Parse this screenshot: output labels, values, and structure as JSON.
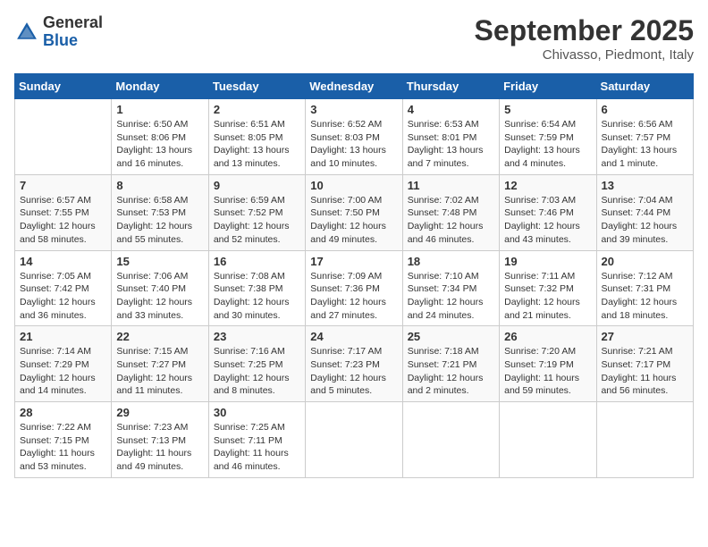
{
  "header": {
    "logo_general": "General",
    "logo_blue": "Blue",
    "month_title": "September 2025",
    "location": "Chivasso, Piedmont, Italy"
  },
  "days_of_week": [
    "Sunday",
    "Monday",
    "Tuesday",
    "Wednesday",
    "Thursday",
    "Friday",
    "Saturday"
  ],
  "weeks": [
    [
      {
        "day": "",
        "info": ""
      },
      {
        "day": "1",
        "info": "Sunrise: 6:50 AM\nSunset: 8:06 PM\nDaylight: 13 hours\nand 16 minutes."
      },
      {
        "day": "2",
        "info": "Sunrise: 6:51 AM\nSunset: 8:05 PM\nDaylight: 13 hours\nand 13 minutes."
      },
      {
        "day": "3",
        "info": "Sunrise: 6:52 AM\nSunset: 8:03 PM\nDaylight: 13 hours\nand 10 minutes."
      },
      {
        "day": "4",
        "info": "Sunrise: 6:53 AM\nSunset: 8:01 PM\nDaylight: 13 hours\nand 7 minutes."
      },
      {
        "day": "5",
        "info": "Sunrise: 6:54 AM\nSunset: 7:59 PM\nDaylight: 13 hours\nand 4 minutes."
      },
      {
        "day": "6",
        "info": "Sunrise: 6:56 AM\nSunset: 7:57 PM\nDaylight: 13 hours\nand 1 minute."
      }
    ],
    [
      {
        "day": "7",
        "info": "Sunrise: 6:57 AM\nSunset: 7:55 PM\nDaylight: 12 hours\nand 58 minutes."
      },
      {
        "day": "8",
        "info": "Sunrise: 6:58 AM\nSunset: 7:53 PM\nDaylight: 12 hours\nand 55 minutes."
      },
      {
        "day": "9",
        "info": "Sunrise: 6:59 AM\nSunset: 7:52 PM\nDaylight: 12 hours\nand 52 minutes."
      },
      {
        "day": "10",
        "info": "Sunrise: 7:00 AM\nSunset: 7:50 PM\nDaylight: 12 hours\nand 49 minutes."
      },
      {
        "day": "11",
        "info": "Sunrise: 7:02 AM\nSunset: 7:48 PM\nDaylight: 12 hours\nand 46 minutes."
      },
      {
        "day": "12",
        "info": "Sunrise: 7:03 AM\nSunset: 7:46 PM\nDaylight: 12 hours\nand 43 minutes."
      },
      {
        "day": "13",
        "info": "Sunrise: 7:04 AM\nSunset: 7:44 PM\nDaylight: 12 hours\nand 39 minutes."
      }
    ],
    [
      {
        "day": "14",
        "info": "Sunrise: 7:05 AM\nSunset: 7:42 PM\nDaylight: 12 hours\nand 36 minutes."
      },
      {
        "day": "15",
        "info": "Sunrise: 7:06 AM\nSunset: 7:40 PM\nDaylight: 12 hours\nand 33 minutes."
      },
      {
        "day": "16",
        "info": "Sunrise: 7:08 AM\nSunset: 7:38 PM\nDaylight: 12 hours\nand 30 minutes."
      },
      {
        "day": "17",
        "info": "Sunrise: 7:09 AM\nSunset: 7:36 PM\nDaylight: 12 hours\nand 27 minutes."
      },
      {
        "day": "18",
        "info": "Sunrise: 7:10 AM\nSunset: 7:34 PM\nDaylight: 12 hours\nand 24 minutes."
      },
      {
        "day": "19",
        "info": "Sunrise: 7:11 AM\nSunset: 7:32 PM\nDaylight: 12 hours\nand 21 minutes."
      },
      {
        "day": "20",
        "info": "Sunrise: 7:12 AM\nSunset: 7:31 PM\nDaylight: 12 hours\nand 18 minutes."
      }
    ],
    [
      {
        "day": "21",
        "info": "Sunrise: 7:14 AM\nSunset: 7:29 PM\nDaylight: 12 hours\nand 14 minutes."
      },
      {
        "day": "22",
        "info": "Sunrise: 7:15 AM\nSunset: 7:27 PM\nDaylight: 12 hours\nand 11 minutes."
      },
      {
        "day": "23",
        "info": "Sunrise: 7:16 AM\nSunset: 7:25 PM\nDaylight: 12 hours\nand 8 minutes."
      },
      {
        "day": "24",
        "info": "Sunrise: 7:17 AM\nSunset: 7:23 PM\nDaylight: 12 hours\nand 5 minutes."
      },
      {
        "day": "25",
        "info": "Sunrise: 7:18 AM\nSunset: 7:21 PM\nDaylight: 12 hours\nand 2 minutes."
      },
      {
        "day": "26",
        "info": "Sunrise: 7:20 AM\nSunset: 7:19 PM\nDaylight: 11 hours\nand 59 minutes."
      },
      {
        "day": "27",
        "info": "Sunrise: 7:21 AM\nSunset: 7:17 PM\nDaylight: 11 hours\nand 56 minutes."
      }
    ],
    [
      {
        "day": "28",
        "info": "Sunrise: 7:22 AM\nSunset: 7:15 PM\nDaylight: 11 hours\nand 53 minutes."
      },
      {
        "day": "29",
        "info": "Sunrise: 7:23 AM\nSunset: 7:13 PM\nDaylight: 11 hours\nand 49 minutes."
      },
      {
        "day": "30",
        "info": "Sunrise: 7:25 AM\nSunset: 7:11 PM\nDaylight: 11 hours\nand 46 minutes."
      },
      {
        "day": "",
        "info": ""
      },
      {
        "day": "",
        "info": ""
      },
      {
        "day": "",
        "info": ""
      },
      {
        "day": "",
        "info": ""
      }
    ]
  ]
}
